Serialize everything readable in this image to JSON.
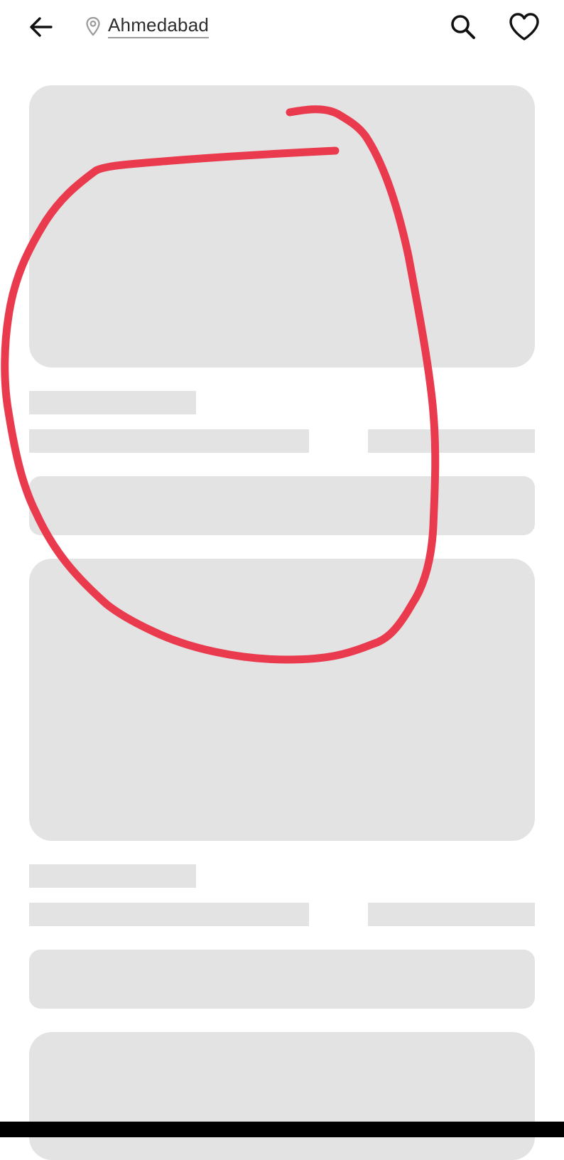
{
  "header": {
    "location_name": "Ahmedabad",
    "icons": {
      "back": "arrow-left-icon",
      "location": "location-pin-icon",
      "search": "search-icon",
      "favorites": "heart-icon"
    }
  },
  "annotation": {
    "shape": "hand-drawn loop",
    "color": "#ea3a4d"
  },
  "colors": {
    "skeleton": "#e3e3e4",
    "background": "#ffffff"
  }
}
